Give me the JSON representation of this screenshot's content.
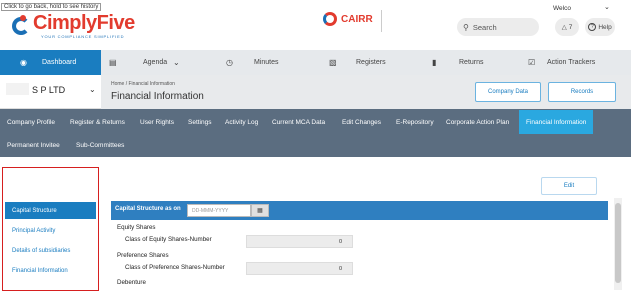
{
  "tooltip": "Click to go back, hold to see history",
  "header": {
    "brand": "CimplyFive",
    "tagline": "YOUR COMPLIANCE SIMPLIFIED",
    "cairr_label": "CAIRR",
    "search_placeholder": "Search",
    "welcome": "Welco",
    "notif_count": "7",
    "help_label": "Help"
  },
  "nav": {
    "items": [
      "Dashboard",
      "Agenda",
      "Minutes",
      "Registers",
      "Returns",
      "Action Trackers"
    ]
  },
  "company": {
    "name": "S P LTD"
  },
  "breadcrumb": {
    "path": "Home / Financial Information",
    "title": "Financial Information"
  },
  "buttons": {
    "company_data": "Company Data",
    "records": "Records",
    "edit": "Edit"
  },
  "tabs": [
    "Company Profile",
    "Register & Returns",
    "User Rights",
    "Settings",
    "Activity Log",
    "Current MCA Data",
    "Edit Changes",
    "E-Repository",
    "Corporate Action Plan",
    "Financial Information",
    "Permanent Invitee",
    "Sub-Committees"
  ],
  "sidebar": {
    "items": [
      "Capital Structure",
      "Principal Activity",
      "Details of subsidiaries",
      "Financial Information"
    ]
  },
  "main": {
    "structure_label": "Capital Structure as on",
    "date_placeholder": "DD-MMM-YYYY",
    "equity_heading": "Equity Shares",
    "equity_label": "Class of Equity Shares-Number",
    "equity_value": "0",
    "pref_heading": "Preference Shares",
    "pref_label": "Class of Preference Shares-Number",
    "pref_value": "0",
    "debenture_heading": "Debenture"
  },
  "colors": {
    "accent": "#1a7dc0",
    "tab_bar": "#5b6d80",
    "active_tab": "#2aa8e0",
    "brand_red": "#e23b2e"
  }
}
